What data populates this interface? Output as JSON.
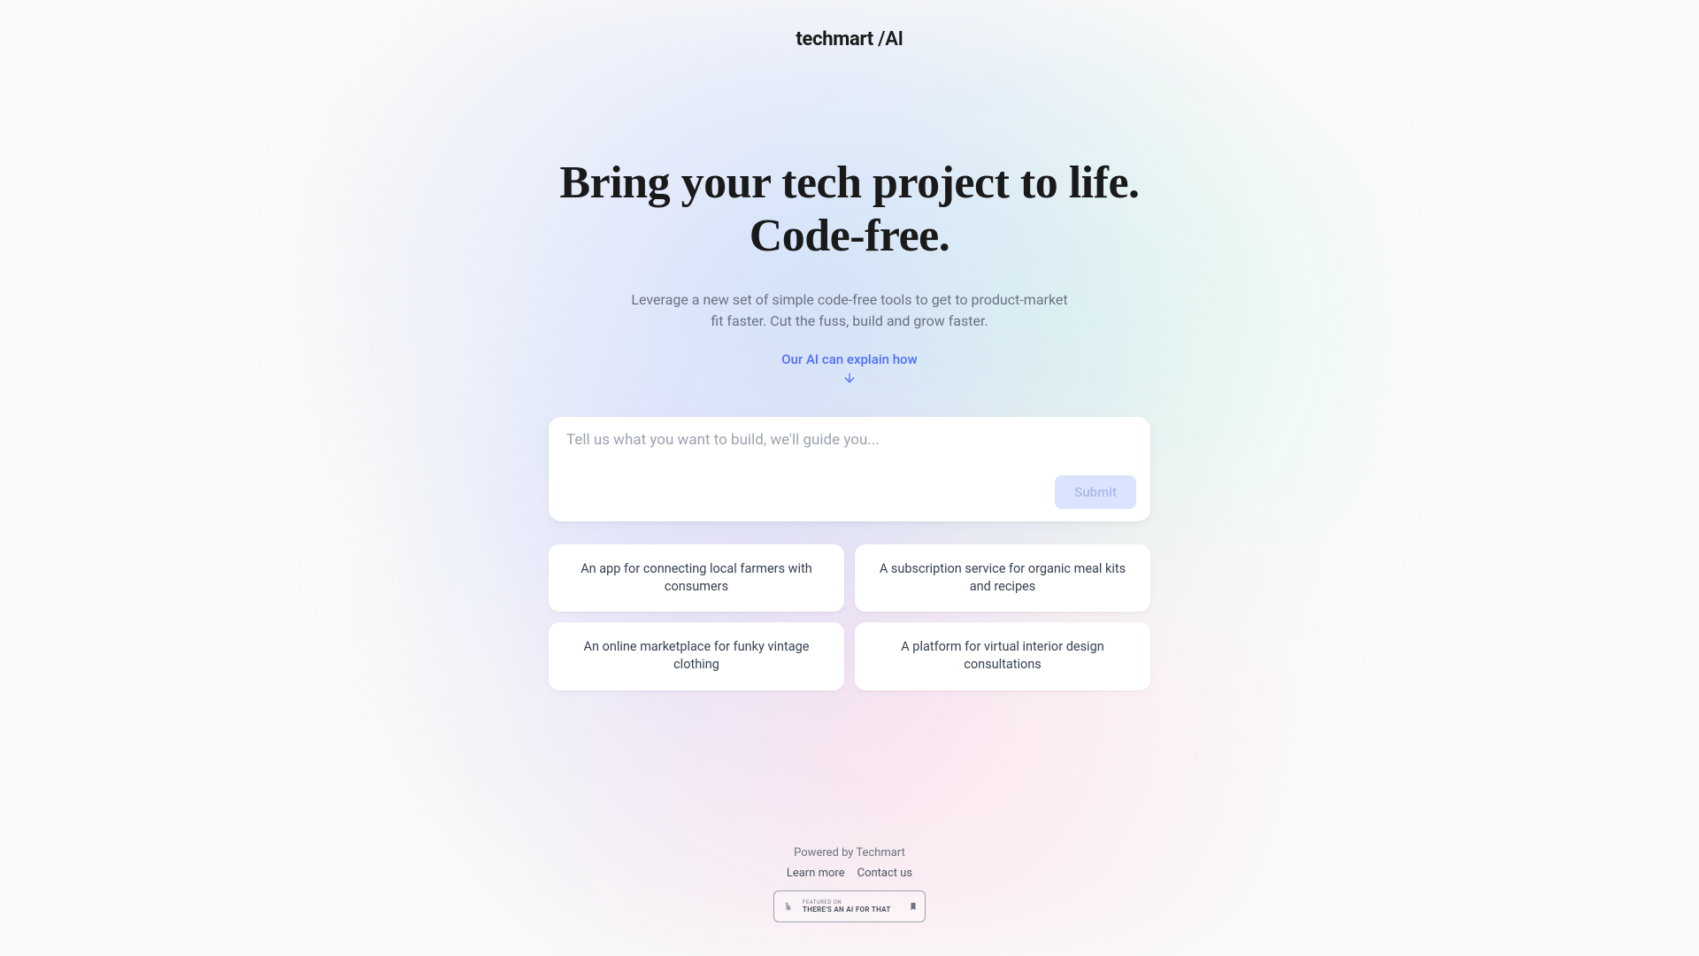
{
  "logo": {
    "main": "techmart",
    "suffix": " /AI"
  },
  "hero": {
    "title_line1": "Bring your tech project to life.",
    "title_line2": "Code-free.",
    "subtitle": "Leverage a new set of simple code-free tools to get to product-market fit faster. Cut the fuss, build and grow faster.",
    "explain_link": "Our AI can explain how"
  },
  "input": {
    "placeholder": "Tell us what you want to build, we'll guide you...",
    "submit_label": "Submit"
  },
  "suggestions": [
    "An app for connecting local farmers with consumers",
    "A subscription service for organic meal kits and recipes",
    "An online marketplace for funky vintage clothing",
    "A platform for virtual interior design consultations"
  ],
  "footer": {
    "powered": "Powered by Techmart",
    "learn_more": "Learn more",
    "contact": "Contact us",
    "badge_top": "FEATURED ON",
    "badge_bottom": "THERE'S AN AI FOR THAT"
  }
}
